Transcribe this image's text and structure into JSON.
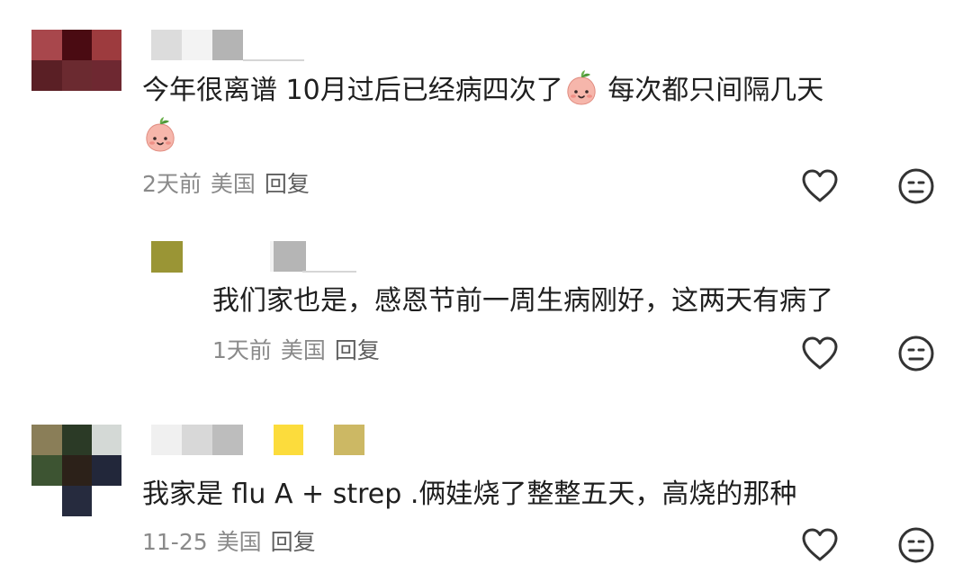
{
  "comments": [
    {
      "text_line1_a": "今年很离谱 10月过后已经病四次了",
      "text_line1_b": " 每次都只间隔几天",
      "emoji_icon": "peach-face-emoji",
      "time": "2天前",
      "location": "美国",
      "reply_label": "回复",
      "replies": [
        {
          "text": "我们家也是，感恩节前一周生病刚好，这两天有病了",
          "time": "1天前",
          "location": "美国",
          "reply_label": "回复"
        }
      ]
    },
    {
      "text": "我家是 flu A + strep .俩娃烧了整整五天，高烧的那种",
      "time": "11-25",
      "location": "美国",
      "reply_label": "回复"
    }
  ],
  "icons": {
    "like": "heart-outline-icon",
    "dislike": "neutral-face-icon"
  },
  "colors": {
    "text": "#1f1f1f",
    "meta": "#8a8a8a",
    "icon_stroke": "#333333",
    "emoji_fill": "#f6b6ab"
  }
}
